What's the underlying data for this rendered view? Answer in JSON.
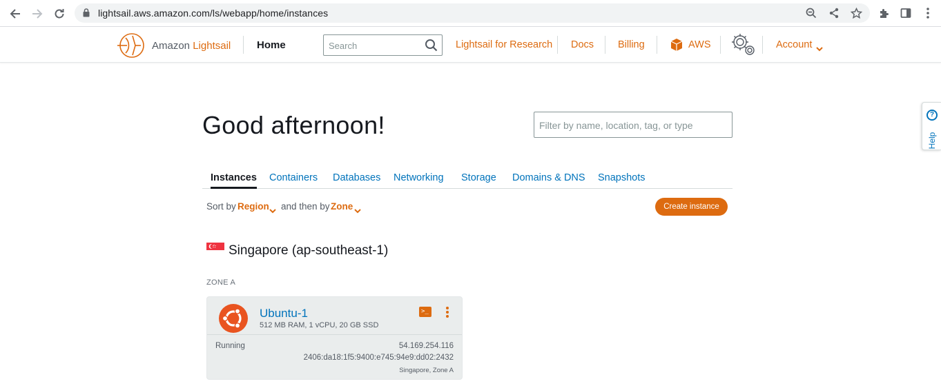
{
  "browser": {
    "url": "lightsail.aws.amazon.com/ls/webapp/home/instances"
  },
  "header": {
    "logo_prefix": "Amazon ",
    "logo_brand": "Lightsail",
    "home_label": "Home",
    "search_placeholder": "Search",
    "links": {
      "research": "Lightsail for Research",
      "docs": "Docs",
      "billing": "Billing",
      "aws": "AWS"
    },
    "account_label": "Account"
  },
  "main": {
    "greeting": "Good afternoon!",
    "filter_placeholder": "Filter by name, location, tag, or type",
    "tabs": [
      {
        "label": "Instances",
        "active": true
      },
      {
        "label": "Containers",
        "active": false
      },
      {
        "label": "Databases",
        "active": false
      },
      {
        "label": "Networking",
        "active": false
      },
      {
        "label": "Storage",
        "active": false
      },
      {
        "label": "Domains & DNS",
        "active": false
      },
      {
        "label": "Snapshots",
        "active": false
      }
    ],
    "sort": {
      "sort_by_label": "Sort by",
      "sort_by_value": "Region",
      "then_by_label": "and then by",
      "then_by_value": "Zone"
    },
    "create_button": "Create instance",
    "region": {
      "title": "Singapore (ap-southeast-1)",
      "flag": "singapore-flag",
      "zone_label": "ZONE A"
    },
    "instance": {
      "name": "Ubuntu-1",
      "spec": "512 MB RAM, 1 vCPU, 20 GB SSD",
      "status": "Running",
      "ipv4": "54.169.254.116",
      "ipv6": "2406:da18:1f5:9400:e745:94e9:dd02:2432",
      "location": "Singapore, Zone A",
      "os_icon": "ubuntu-icon",
      "terminal_glyph": ">_"
    }
  },
  "help": {
    "label": "Help",
    "icon_glyph": "?"
  },
  "colors": {
    "accent": "#dd6b10",
    "link": "#0073bb",
    "text": "#16191f",
    "card_bg": "#eaeded"
  }
}
